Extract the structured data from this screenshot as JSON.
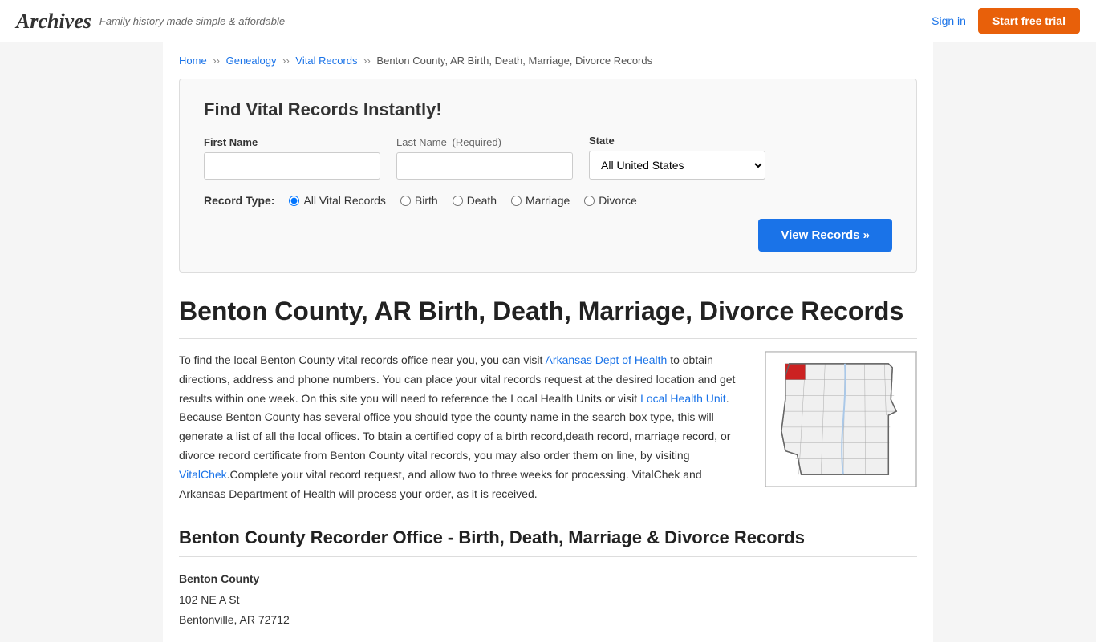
{
  "header": {
    "logo": "Archives",
    "tagline": "Family history made simple & affordable",
    "sign_in_label": "Sign in",
    "trial_button_label": "Start free trial"
  },
  "breadcrumb": {
    "home": "Home",
    "genealogy": "Genealogy",
    "vital_records": "Vital Records",
    "current": "Benton County, AR Birth, Death, Marriage, Divorce Records"
  },
  "search": {
    "title": "Find Vital Records Instantly!",
    "first_name_label": "First Name",
    "last_name_label": "Last Name",
    "last_name_required": "(Required)",
    "state_label": "State",
    "state_default": "All United States",
    "record_type_label": "Record Type:",
    "record_types": [
      "All Vital Records",
      "Birth",
      "Death",
      "Marriage",
      "Divorce"
    ],
    "view_button_label": "View Records »"
  },
  "page_title": "Benton County, AR Birth, Death, Marriage, Divorce Records",
  "content_body": "To find the local Benton County vital records office near you, you can visit Arkansas Dept of Health to obtain directions, address and phone numbers. You can place your vital records request at the desired location and get results within one week. On this site you will need to reference the Local Health Units or visit Local Health Unit. Because Benton County has several office you should type the county name in the search box type, this will generate a list of all the local offices. To btain a certified copy of a birth record,death record, marriage record, or divorce record certificate from Benton County vital records, you may also order them on line, by visiting VitalChek.Complete your vital record request, and allow two to three weeks for processing. VitalChek and Arkansas Department of Health will process your order, as it is received.",
  "recorder_title": "Benton County Recorder Office - Birth, Death, Marriage & Divorce Records",
  "county_name": "Benton County",
  "county_address1": "102 NE A St",
  "county_address2": "Bentonville, AR 72712"
}
